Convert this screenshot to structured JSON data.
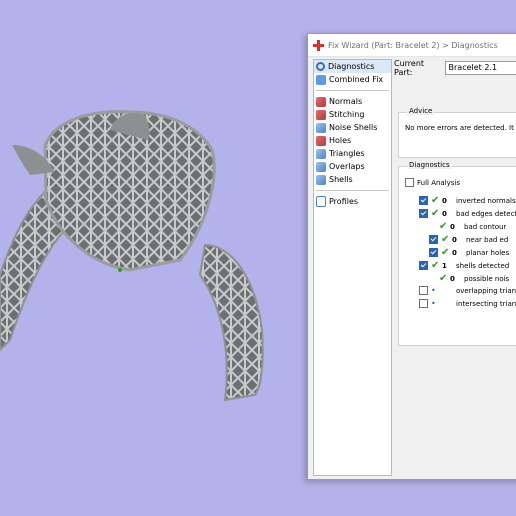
{
  "window": {
    "title": "Fix Wizard (Part: Bracelet 2) > Diagnostics"
  },
  "nav": {
    "items": [
      {
        "label": "Diagnostics",
        "icon": "magnifier-icon",
        "selected": true
      },
      {
        "label": "Combined Fix",
        "icon": "combined-fix-icon"
      },
      {
        "label": "Normals",
        "icon": "normals-icon"
      },
      {
        "label": "Stitching",
        "icon": "stitching-icon"
      },
      {
        "label": "Noise Shells",
        "icon": "noise-shells-icon"
      },
      {
        "label": "Holes",
        "icon": "holes-icon"
      },
      {
        "label": "Triangles",
        "icon": "triangles-icon"
      },
      {
        "label": "Overlaps",
        "icon": "overlaps-icon"
      },
      {
        "label": "Shells",
        "icon": "shells-icon"
      },
      {
        "label": "Profiles",
        "icon": "profiles-icon"
      }
    ]
  },
  "current_part": {
    "label": "Current Part:",
    "value": "Bracelet 2.1"
  },
  "advice": {
    "title": "Advice",
    "text": "No more errors are detected. It seem"
  },
  "diagnostics": {
    "title": "Diagnostics",
    "full_analysis": "Full Analysis",
    "rows": [
      {
        "count": "0",
        "label": "inverted normals",
        "checked": true,
        "status": "ok"
      },
      {
        "count": "0",
        "label": "bad edges detect",
        "checked": true,
        "status": "ok"
      },
      {
        "count": "0",
        "label": "bad contour",
        "checked": null,
        "status": "ok"
      },
      {
        "count": "0",
        "label": "near bad ed",
        "checked": true,
        "status": "ok"
      },
      {
        "count": "0",
        "label": "planar holes",
        "checked": true,
        "status": "ok"
      },
      {
        "count": "1",
        "label": "shells detected",
        "checked": true,
        "status": "ok"
      },
      {
        "count": "0",
        "label": "possible nois",
        "checked": null,
        "status": "ok"
      },
      {
        "count": "",
        "label": "overlapping trian",
        "checked": false,
        "status": "unknown"
      },
      {
        "count": "",
        "label": "intersecting trian",
        "checked": false,
        "status": "unknown"
      }
    ]
  },
  "colors": {
    "background": "#b3b2ea",
    "model": "#8d8f90",
    "check": "#2f9b2a",
    "accent": "#2a63b8"
  }
}
